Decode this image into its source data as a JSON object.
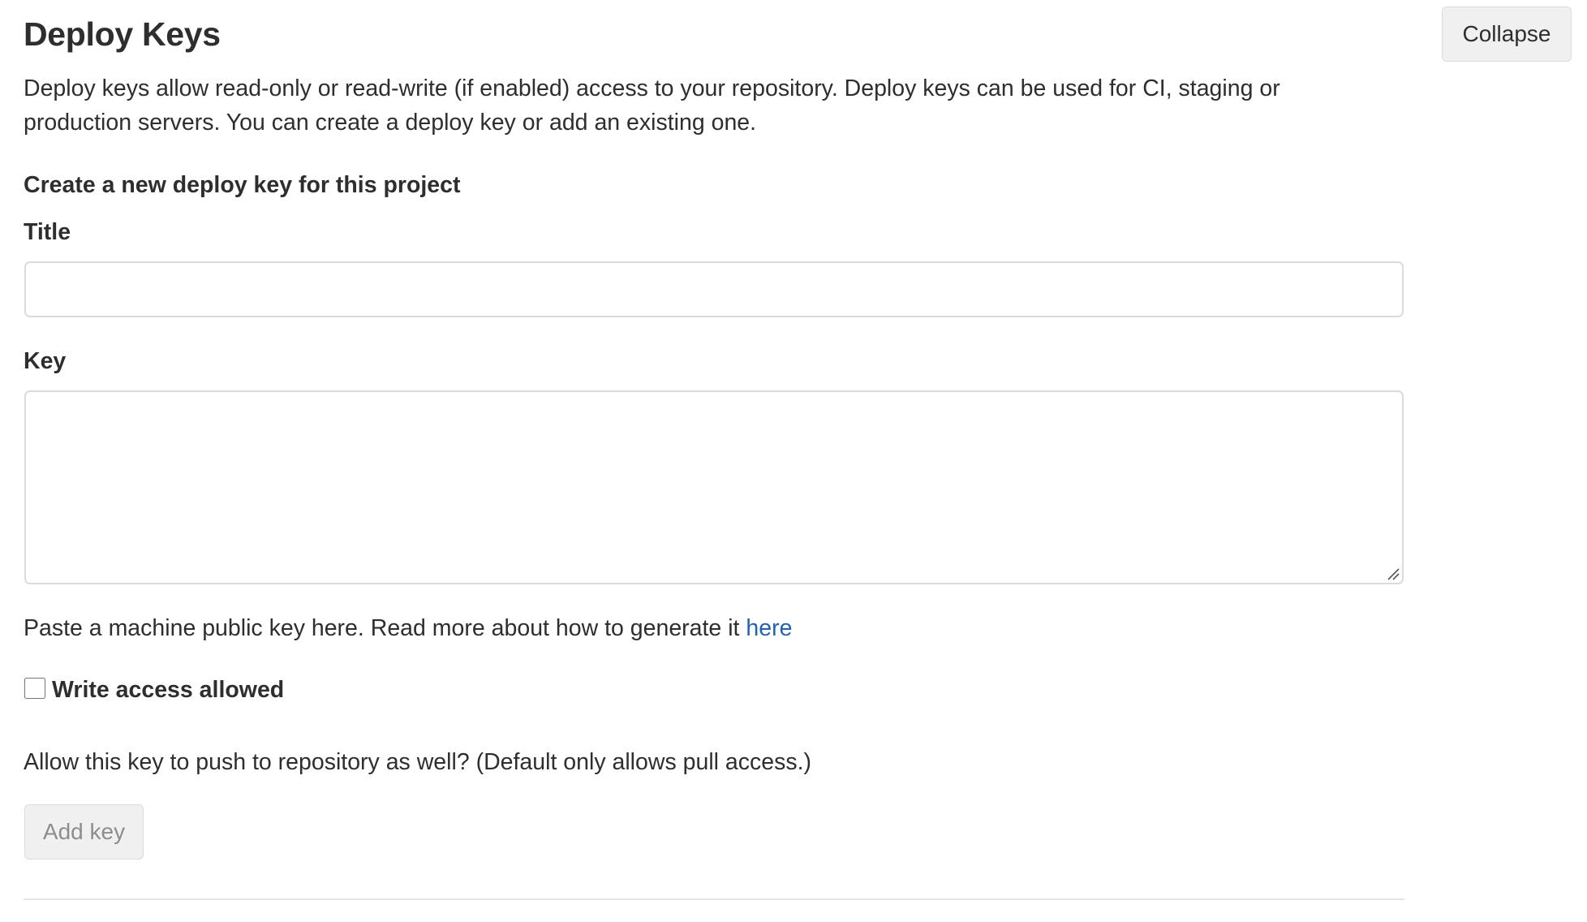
{
  "section": {
    "title": "Deploy Keys",
    "collapse_label": "Collapse",
    "description": "Deploy keys allow read-only or read-write (if enabled) access to your repository. Deploy keys can be used for CI, staging or production servers. You can create a deploy key or add an existing one."
  },
  "form": {
    "heading": "Create a new deploy key for this project",
    "title_label": "Title",
    "title_value": "",
    "key_label": "Key",
    "key_value": "",
    "key_help_text": "Paste a machine public key here. Read more about how to generate it ",
    "key_help_link": "here",
    "write_access_label": "Write access allowed",
    "write_access_checked": false,
    "write_access_help": "Allow this key to push to repository as well? (Default only allows pull access.)",
    "submit_label": "Add key",
    "submit_disabled": true
  },
  "colors": {
    "text": "#2e2e2e",
    "link": "#1f62b8",
    "border": "#dbdbdb",
    "button_bg": "#f0f0f0",
    "disabled_text": "#8d8d8d"
  }
}
